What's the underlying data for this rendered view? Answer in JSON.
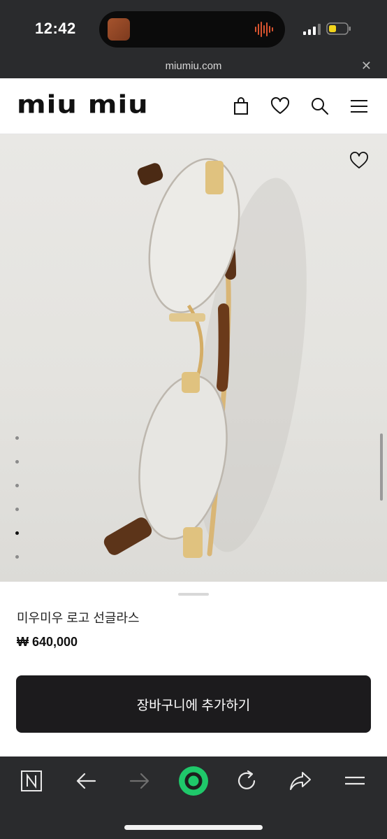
{
  "status_bar": {
    "time": "12:42"
  },
  "browser": {
    "url": "miumiu.com",
    "close_glyph": "✕"
  },
  "header": {
    "logo": "miu miu",
    "icons": [
      "shopping-bag-icon",
      "heart-icon",
      "search-icon",
      "menu-icon"
    ]
  },
  "gallery": {
    "image": "glasses-product-photo",
    "dot_count": 6,
    "active_dot": 5
  },
  "product": {
    "name": "미우미우 로고 선글라스",
    "price": "₩ 640,000"
  },
  "cta": {
    "label": "장바구니에 추가하기"
  },
  "toolbar": {
    "icons": [
      "n-tab-icon",
      "back-arrow-icon",
      "forward-arrow-icon",
      "home-circle-icon",
      "reload-icon",
      "share-icon",
      "menu-lines-icon"
    ]
  },
  "colors": {
    "status_bg": "#2a2b2d",
    "cta_bg": "#1c1b1d",
    "accent_green": "#1fc86a"
  }
}
